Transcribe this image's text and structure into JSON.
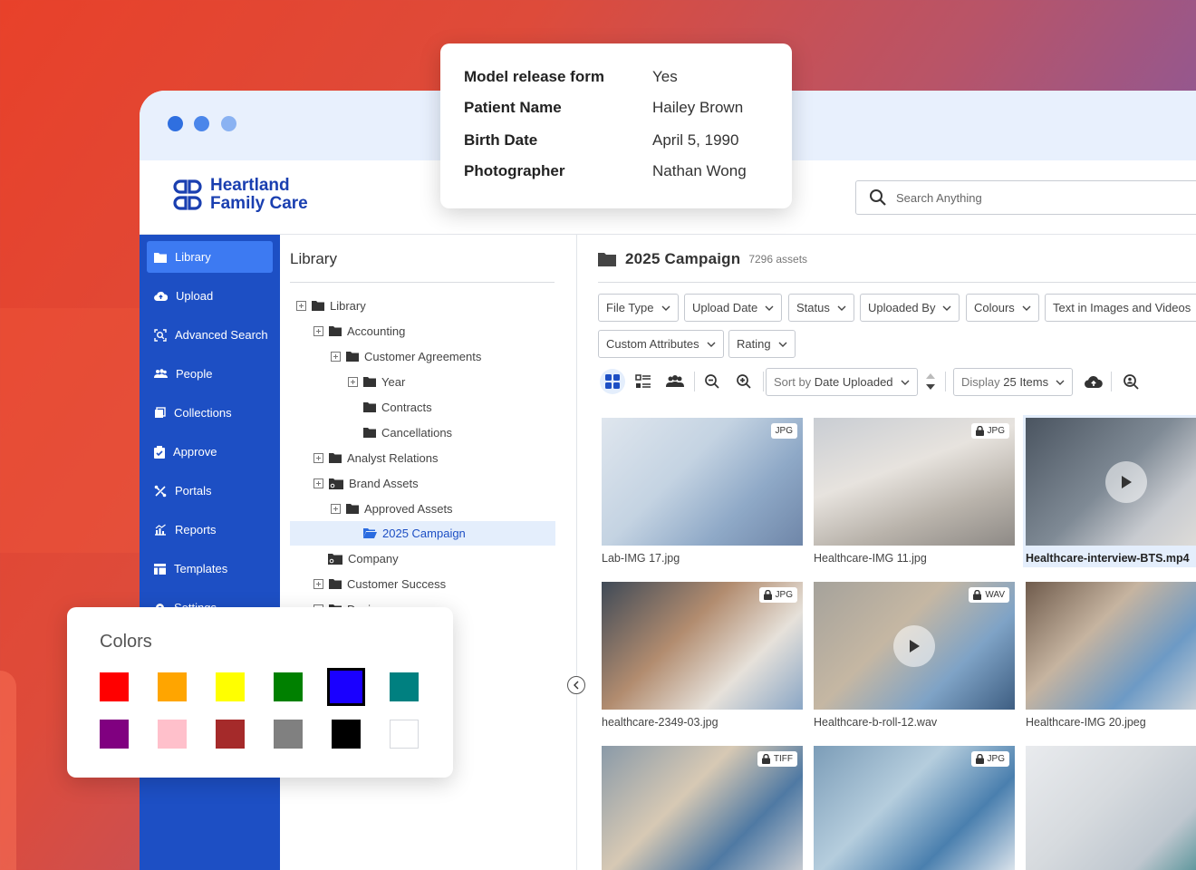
{
  "brand": {
    "line1": "Heartland",
    "line2": "Family Care",
    "color": "#1a3fb0"
  },
  "search": {
    "placeholder": "Search Anything"
  },
  "sidebar": {
    "items": [
      {
        "label": "Library",
        "icon": "folder-icon",
        "active": true
      },
      {
        "label": "Upload",
        "icon": "cloud-upload-icon"
      },
      {
        "label": "Advanced Search",
        "icon": "advanced-search-icon"
      },
      {
        "label": "People",
        "icon": "people-icon"
      },
      {
        "label": "Collections",
        "icon": "collections-icon"
      },
      {
        "label": "Approve",
        "icon": "approve-icon"
      },
      {
        "label": "Portals",
        "icon": "portals-icon"
      },
      {
        "label": "Reports",
        "icon": "reports-icon"
      },
      {
        "label": "Templates",
        "icon": "templates-icon"
      },
      {
        "label": "Settings",
        "icon": "gear-icon"
      }
    ]
  },
  "tree": {
    "title": "Library",
    "nodes": [
      {
        "label": "Library"
      },
      {
        "label": "Accounting"
      },
      {
        "label": "Customer Agreements"
      },
      {
        "label": "Year"
      },
      {
        "label": "Contracts"
      },
      {
        "label": "Cancellations"
      },
      {
        "label": "Analyst Relations"
      },
      {
        "label": "Brand Assets"
      },
      {
        "label": "Approved Assets"
      },
      {
        "label": "2025 Campaign",
        "selected": true
      },
      {
        "label": "Company"
      },
      {
        "label": "Customer Success"
      },
      {
        "label": "Design"
      }
    ]
  },
  "main": {
    "title": "2025 Campaign",
    "count": "7296 assets",
    "filters": [
      "File Type",
      "Upload Date",
      "Status",
      "Uploaded By",
      "Colours",
      "Text in Images and Videos",
      "Custom Attributes",
      "Rating"
    ],
    "sort": {
      "prefix": "Sort by ",
      "value": "Date Uploaded"
    },
    "display": {
      "prefix": "Display ",
      "value": "25 Items"
    },
    "assets": [
      {
        "name": "Lab-IMG 17.jpg",
        "type": "JPG",
        "locked": false
      },
      {
        "name": "Healthcare-IMG 11.jpg",
        "type": "JPG",
        "locked": true
      },
      {
        "name": "Healthcare-interview-BTS.mp4",
        "type": "",
        "video": true,
        "selected": true
      },
      {
        "name": "healthcare-2349-03.jpg",
        "type": "JPG",
        "locked": true
      },
      {
        "name": "Healthcare-b-roll-12.wav",
        "type": "WAV",
        "locked": true,
        "video": true
      },
      {
        "name": "Healthcare-IMG 20.jpeg",
        "type": "",
        "locked": true
      },
      {
        "name": "",
        "type": "TIFF",
        "locked": true
      },
      {
        "name": "",
        "type": "JPG",
        "locked": true
      },
      {
        "name": "",
        "type": "",
        "locked": false
      }
    ]
  },
  "metadata": {
    "rows": [
      {
        "key": "Model release form",
        "value": "Yes"
      },
      {
        "key": "Patient Name",
        "value": "Hailey Brown"
      },
      {
        "key": "Birth Date",
        "value": "April 5, 1990"
      },
      {
        "key": "Photographer",
        "value": "Nathan Wong"
      }
    ]
  },
  "colors": {
    "title": "Colors",
    "swatches": [
      "#ff0000",
      "#ffa500",
      "#ffff00",
      "#008000",
      "#1a00ff",
      "#008080",
      "#800080",
      "#ffc0cb",
      "#a52a2a",
      "#808080",
      "#000000",
      "#ffffff"
    ],
    "selected": "#1a00ff"
  }
}
